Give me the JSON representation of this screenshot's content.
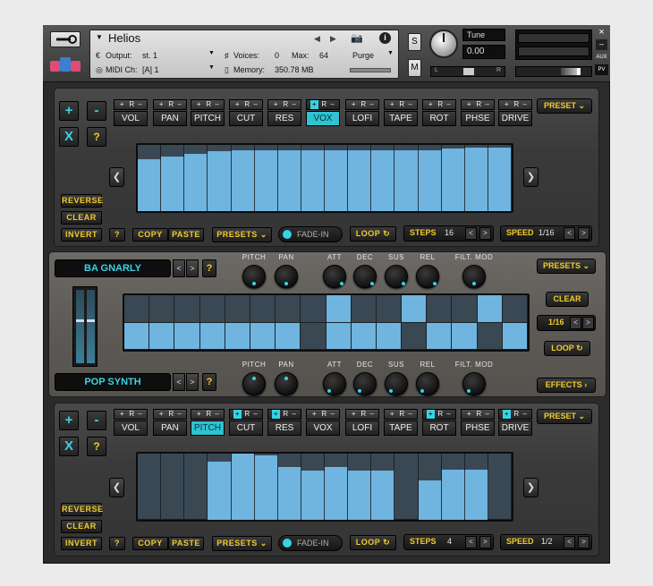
{
  "header": {
    "title": "Helios",
    "output_label": "Output:",
    "output_value": "st. 1",
    "midi_label": "MIDI Ch:",
    "midi_value": "[A]  1",
    "voices_label": "Voices:",
    "voices_value": "0",
    "max_label": "Max:",
    "max_value": "64",
    "memory_label": "Memory:",
    "memory_value": "350.78 MB",
    "purge_label": "Purge",
    "solo_label": "S",
    "mute_label": "M",
    "tune_label": "Tune",
    "tune_value": "0.00",
    "pan_left": "L",
    "pan_right": "R",
    "aux_label": "AUX",
    "pv_label": "PV",
    "close_glyph": "×",
    "minimize_glyph": "–",
    "info_glyph": "i",
    "prev_glyph": "◀",
    "next_glyph": "▶"
  },
  "top_sequencer": {
    "plus_label": "+",
    "minus_label": "-",
    "x_label": "X",
    "help_label": "?",
    "params": [
      {
        "label": "VOL",
        "selected": false,
        "active": false
      },
      {
        "label": "PAN",
        "selected": false,
        "active": false
      },
      {
        "label": "PITCH",
        "selected": false,
        "active": false
      },
      {
        "label": "CUT",
        "selected": false,
        "active": false
      },
      {
        "label": "RES",
        "selected": false,
        "active": false
      },
      {
        "label": "VOX",
        "selected": true,
        "active": true
      },
      {
        "label": "LOFI",
        "selected": false,
        "active": false
      },
      {
        "label": "TAPE",
        "selected": false,
        "active": false
      },
      {
        "label": "ROT",
        "selected": false,
        "active": false
      },
      {
        "label": "PHSE",
        "selected": false,
        "active": false
      },
      {
        "label": "DRIVE",
        "selected": false,
        "active": false
      }
    ],
    "param_button_text": "+ R –",
    "preset_label": "PRESET",
    "step_values": [
      0.78,
      0.82,
      0.87,
      0.9,
      0.92,
      0.92,
      0.92,
      0.92,
      0.92,
      0.92,
      0.92,
      0.92,
      0.92,
      0.94,
      0.96,
      0.96
    ],
    "reverse_label": "REVERSE",
    "clear_label": "CLEAR",
    "invert_label": "INVERT",
    "help2_label": "?",
    "copy_label": "COPY",
    "paste_label": "PASTE",
    "presets_label": "PRESETS",
    "fade_in_label": "FADE-IN",
    "loop_label": "LOOP",
    "steps_label": "STEPS",
    "steps_value": "16",
    "speed_label": "SPEED",
    "speed_value": "1/16",
    "left_arrow": "❮",
    "right_arrow": "❯"
  },
  "middle_panel": {
    "preset_top": "BA GNARLY",
    "preset_bottom": "POP SYNTH",
    "help_label": "?",
    "knob_labels": [
      "PITCH",
      "PAN",
      "ATT",
      "DEC",
      "SUS",
      "REL",
      "FILT. MOD"
    ],
    "presets_label": "PRESETS",
    "clear_label": "CLEAR",
    "rate_value": "1/16",
    "loop_label": "LOOP",
    "effects_label": "EFFECTS",
    "grid_top_row": [
      false,
      false,
      false,
      false,
      false,
      false,
      false,
      false,
      true,
      false,
      false,
      true,
      false,
      false,
      true,
      false
    ],
    "grid_bottom_row": [
      true,
      true,
      true,
      true,
      true,
      true,
      true,
      false,
      true,
      true,
      true,
      false,
      true,
      true,
      false,
      true
    ]
  },
  "bottom_sequencer": {
    "plus_label": "+",
    "minus_label": "-",
    "x_label": "X",
    "help_label": "?",
    "params": [
      {
        "label": "VOL",
        "selected": false,
        "active": false
      },
      {
        "label": "PAN",
        "selected": false,
        "active": false
      },
      {
        "label": "PITCH",
        "selected": true,
        "active": false
      },
      {
        "label": "CUT",
        "selected": false,
        "active": true
      },
      {
        "label": "RES",
        "selected": false,
        "active": true
      },
      {
        "label": "VOX",
        "selected": false,
        "active": false
      },
      {
        "label": "LOFI",
        "selected": false,
        "active": false
      },
      {
        "label": "TAPE",
        "selected": false,
        "active": false
      },
      {
        "label": "ROT",
        "selected": false,
        "active": true
      },
      {
        "label": "PHSE",
        "selected": false,
        "active": false
      },
      {
        "label": "DRIVE",
        "selected": false,
        "active": true
      }
    ],
    "param_button_text": "+ R –",
    "preset_label": "PRESET",
    "step_values": [
      0.0,
      0.0,
      0.0,
      0.88,
      1.0,
      0.97,
      0.8,
      0.75,
      0.8,
      0.75,
      0.75,
      0.0,
      0.6,
      0.76,
      0.76,
      0.0
    ],
    "reverse_label": "REVERSE",
    "clear_label": "CLEAR",
    "invert_label": "INVERT",
    "help2_label": "?",
    "copy_label": "COPY",
    "paste_label": "PASTE",
    "presets_label": "PRESETS",
    "fade_in_label": "FADE-IN",
    "loop_label": "LOOP",
    "steps_label": "STEPS",
    "steps_value": "4",
    "speed_label": "SPEED",
    "speed_value": "1/2",
    "left_arrow": "❮",
    "right_arrow": "❯"
  },
  "colors": {
    "accent_cyan": "#38d3e3",
    "accent_yellow": "#f2cc2a",
    "step_blue": "#6fb5e0",
    "background": "#2b2b2b"
  }
}
